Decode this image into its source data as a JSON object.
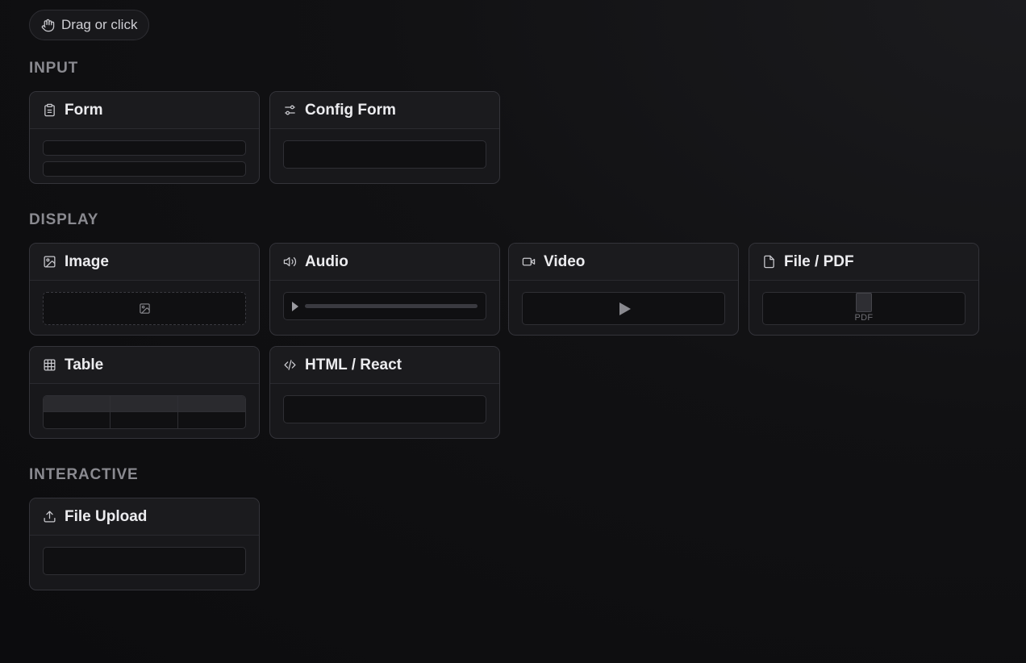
{
  "toolbar": {
    "drag_label": "Drag or click",
    "drag_icon": "hand-icon"
  },
  "sections": {
    "input": {
      "title": "INPUT",
      "cards": {
        "form": {
          "label": "Form",
          "icon": "clipboard-icon"
        },
        "config_form": {
          "label": "Config Form",
          "icon": "sliders-icon"
        }
      }
    },
    "display": {
      "title": "DISPLAY",
      "cards": {
        "image": {
          "label": "Image",
          "icon": "image-icon"
        },
        "audio": {
          "label": "Audio",
          "icon": "speaker-icon"
        },
        "video": {
          "label": "Video",
          "icon": "video-camera-icon"
        },
        "file_pdf": {
          "label": "File / PDF",
          "icon": "file-icon",
          "preview_label": "PDF"
        },
        "table": {
          "label": "Table",
          "icon": "table-icon"
        },
        "html_react": {
          "label": "HTML / React",
          "icon": "code-icon"
        }
      }
    },
    "interactive": {
      "title": "INTERACTIVE",
      "cards": {
        "file_upload": {
          "label": "File Upload",
          "icon": "upload-icon"
        }
      }
    }
  },
  "colors": {
    "background": "#111113",
    "card": "#18181b",
    "border": "#34343a",
    "section_title": "#8a8a90"
  }
}
